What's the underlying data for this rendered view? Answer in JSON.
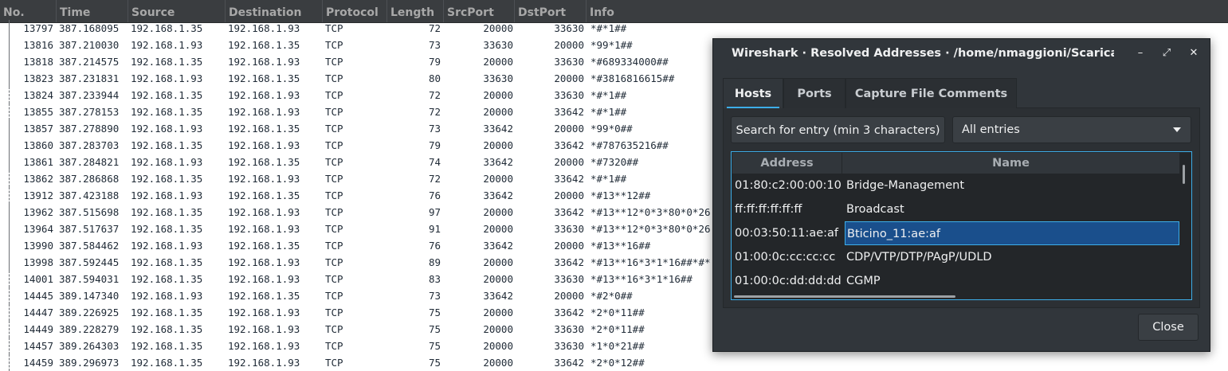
{
  "packet_list": {
    "columns": [
      "No.",
      "Time",
      "Source",
      "Destination",
      "Protocol",
      "Length",
      "SrcPort",
      "DstPort",
      "Info"
    ],
    "rows": [
      [
        "13797",
        "387.168095",
        "192.168.1.35",
        "192.168.1.93",
        "TCP",
        "72",
        "20000",
        "33630",
        "*#*1##"
      ],
      [
        "13816",
        "387.210030",
        "192.168.1.93",
        "192.168.1.35",
        "TCP",
        "73",
        "33630",
        "20000",
        "*99*1##"
      ],
      [
        "13818",
        "387.214575",
        "192.168.1.35",
        "192.168.1.93",
        "TCP",
        "79",
        "20000",
        "33630",
        "*#689334000##"
      ],
      [
        "13823",
        "387.231831",
        "192.168.1.93",
        "192.168.1.35",
        "TCP",
        "80",
        "33630",
        "20000",
        "*#3816816615##"
      ],
      [
        "13824",
        "387.233944",
        "192.168.1.35",
        "192.168.1.93",
        "TCP",
        "72",
        "20000",
        "33630",
        "*#*1##"
      ],
      [
        "13855",
        "387.278153",
        "192.168.1.35",
        "192.168.1.93",
        "TCP",
        "72",
        "20000",
        "33642",
        "*#*1##"
      ],
      [
        "13857",
        "387.278890",
        "192.168.1.93",
        "192.168.1.35",
        "TCP",
        "73",
        "33642",
        "20000",
        "*99*0##"
      ],
      [
        "13860",
        "387.283703",
        "192.168.1.35",
        "192.168.1.93",
        "TCP",
        "79",
        "20000",
        "33642",
        "*#787635216##"
      ],
      [
        "13861",
        "387.284821",
        "192.168.1.93",
        "192.168.1.35",
        "TCP",
        "74",
        "33642",
        "20000",
        "*#7320##"
      ],
      [
        "13862",
        "387.286868",
        "192.168.1.35",
        "192.168.1.93",
        "TCP",
        "72",
        "20000",
        "33642",
        "*#*1##"
      ],
      [
        "13912",
        "387.423188",
        "192.168.1.93",
        "192.168.1.35",
        "TCP",
        "76",
        "33642",
        "20000",
        "*#13**12##"
      ],
      [
        "13962",
        "387.515698",
        "192.168.1.35",
        "192.168.1.93",
        "TCP",
        "97",
        "20000",
        "33642",
        "*#13**12*0*3*80*0*26"
      ],
      [
        "13964",
        "387.517637",
        "192.168.1.35",
        "192.168.1.93",
        "TCP",
        "91",
        "20000",
        "33630",
        "*#13**12*0*3*80*0*26"
      ],
      [
        "13990",
        "387.584462",
        "192.168.1.93",
        "192.168.1.35",
        "TCP",
        "76",
        "33642",
        "20000",
        "*#13**16##"
      ],
      [
        "13998",
        "387.592445",
        "192.168.1.35",
        "192.168.1.93",
        "TCP",
        "89",
        "20000",
        "33642",
        "*#13**16*3*1*16##*#*"
      ],
      [
        "14001",
        "387.594031",
        "192.168.1.35",
        "192.168.1.93",
        "TCP",
        "83",
        "20000",
        "33630",
        "*#13**16*3*1*16##"
      ],
      [
        "14445",
        "389.147340",
        "192.168.1.93",
        "192.168.1.35",
        "TCP",
        "73",
        "33642",
        "20000",
        "*#2*0##"
      ],
      [
        "14447",
        "389.226925",
        "192.168.1.35",
        "192.168.1.93",
        "TCP",
        "75",
        "20000",
        "33642",
        "*2*0*11##"
      ],
      [
        "14449",
        "389.228279",
        "192.168.1.35",
        "192.168.1.93",
        "TCP",
        "75",
        "20000",
        "33630",
        "*2*0*11##"
      ],
      [
        "14457",
        "389.264303",
        "192.168.1.35",
        "192.168.1.93",
        "TCP",
        "75",
        "20000",
        "33630",
        "*1*0*21##"
      ],
      [
        "14459",
        "389.296973",
        "192.168.1.35",
        "192.168.1.93",
        "TCP",
        "75",
        "20000",
        "33642",
        "*2*0*12##"
      ]
    ]
  },
  "dialog": {
    "title": "Wireshark · Resolved Addresses · /home/nmaggioni/Scaricati/s...",
    "window_buttons": {
      "minimize": "–",
      "maximize": "⤢",
      "close": "✕"
    },
    "tabs": [
      {
        "label": "Hosts",
        "active": true
      },
      {
        "label": "Ports",
        "active": false
      },
      {
        "label": "Capture File Comments",
        "active": false
      }
    ],
    "search_label": "Search for entry (min 3 characters)",
    "filter_selected": "All entries",
    "table": {
      "headers": [
        "Address",
        "Name"
      ],
      "rows": [
        {
          "address": "01:80:c2:00:00:10",
          "name": "Bridge-Management",
          "selected": false
        },
        {
          "address": "ff:ff:ff:ff:ff:ff",
          "name": "Broadcast",
          "selected": false
        },
        {
          "address": "00:03:50:11:ae:af",
          "name": "Bticino_11:ae:af",
          "selected": true
        },
        {
          "address": "01:00:0c:cc:cc:cc",
          "name": "CDP/VTP/DTP/PAgP/UDLD",
          "selected": false
        },
        {
          "address": "01:00:0c:dd:dd:dd",
          "name": "CGMP",
          "selected": false
        }
      ]
    },
    "close_label": "Close"
  },
  "colors": {
    "header_bg": "#3a3d40",
    "dialog_bg": "#31363b",
    "accent": "#3daee9",
    "selection": "#1a4f8c"
  }
}
